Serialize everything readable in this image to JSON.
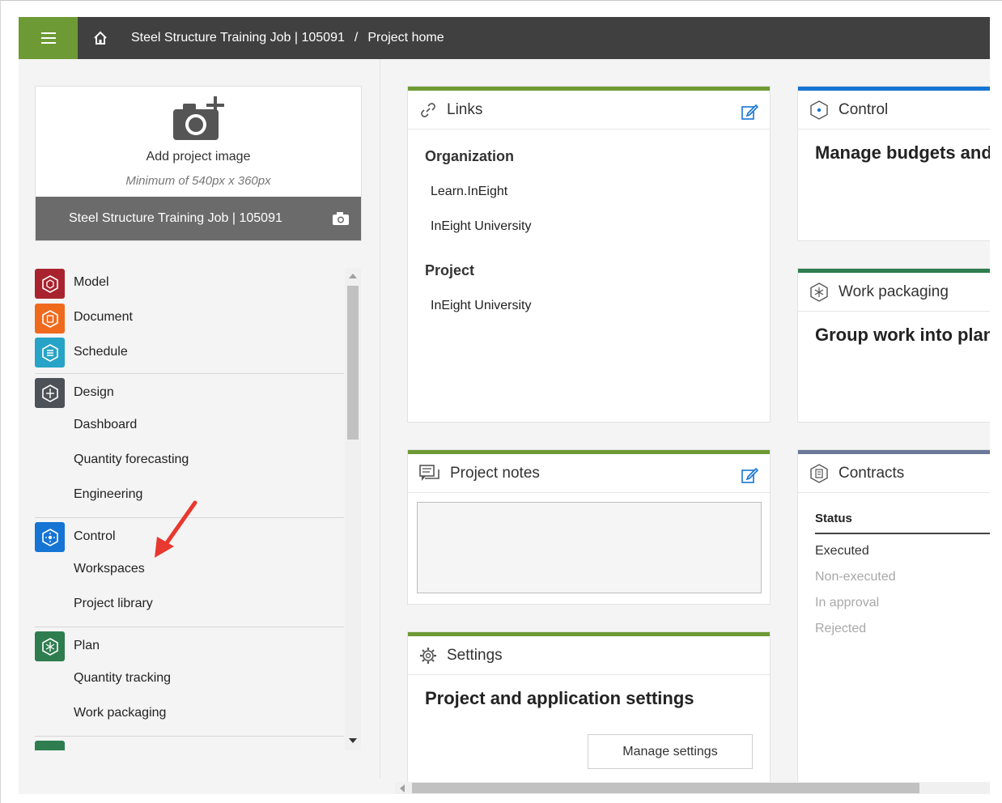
{
  "header": {
    "breadcrumb_project": "Steel Structure Training Job | 105091",
    "breadcrumb_sep": "/",
    "breadcrumb_page": "Project home"
  },
  "project_image": {
    "add_label": "Add project image",
    "min_size": "Minimum of 540px x 360px",
    "job_name": "Steel Structure Training Job | 105091"
  },
  "nav": {
    "model": "Model",
    "document": "Document",
    "schedule": "Schedule",
    "design": "Design",
    "dashboard": "Dashboard",
    "quantity_forecasting": "Quantity forecasting",
    "engineering": "Engineering",
    "control": "Control",
    "workspaces": "Workspaces",
    "project_library": "Project library",
    "plan": "Plan",
    "quantity_tracking": "Quantity tracking",
    "work_packaging": "Work packaging"
  },
  "links_card": {
    "title": "Links",
    "org_heading": "Organization",
    "org_links": [
      "Learn.InEight",
      "InEight University"
    ],
    "project_heading": "Project",
    "project_links": [
      "InEight University"
    ]
  },
  "notes_card": {
    "title": "Project notes"
  },
  "settings_card": {
    "title": "Settings",
    "heading": "Project and application settings",
    "button": "Manage settings"
  },
  "control_card": {
    "title": "Control",
    "heading": "Manage budgets and"
  },
  "workpack_card": {
    "title": "Work packaging",
    "heading": "Group work into plan"
  },
  "contracts_card": {
    "title": "Contracts",
    "status_label": "Status",
    "statuses": [
      "Executed",
      "Non-executed",
      "In approval",
      "Rejected"
    ]
  },
  "colors": {
    "accent_green": "#6d9a34",
    "control_blue": "#1574d4",
    "plan_green": "#2e7d4f",
    "contracts_slate": "#6b7899",
    "model_red": "#a8232e",
    "document_orange": "#f06a1d",
    "schedule_teal": "#27a3c7",
    "design_gray": "#4d5258",
    "annotation_arrow": "#e8382f"
  }
}
